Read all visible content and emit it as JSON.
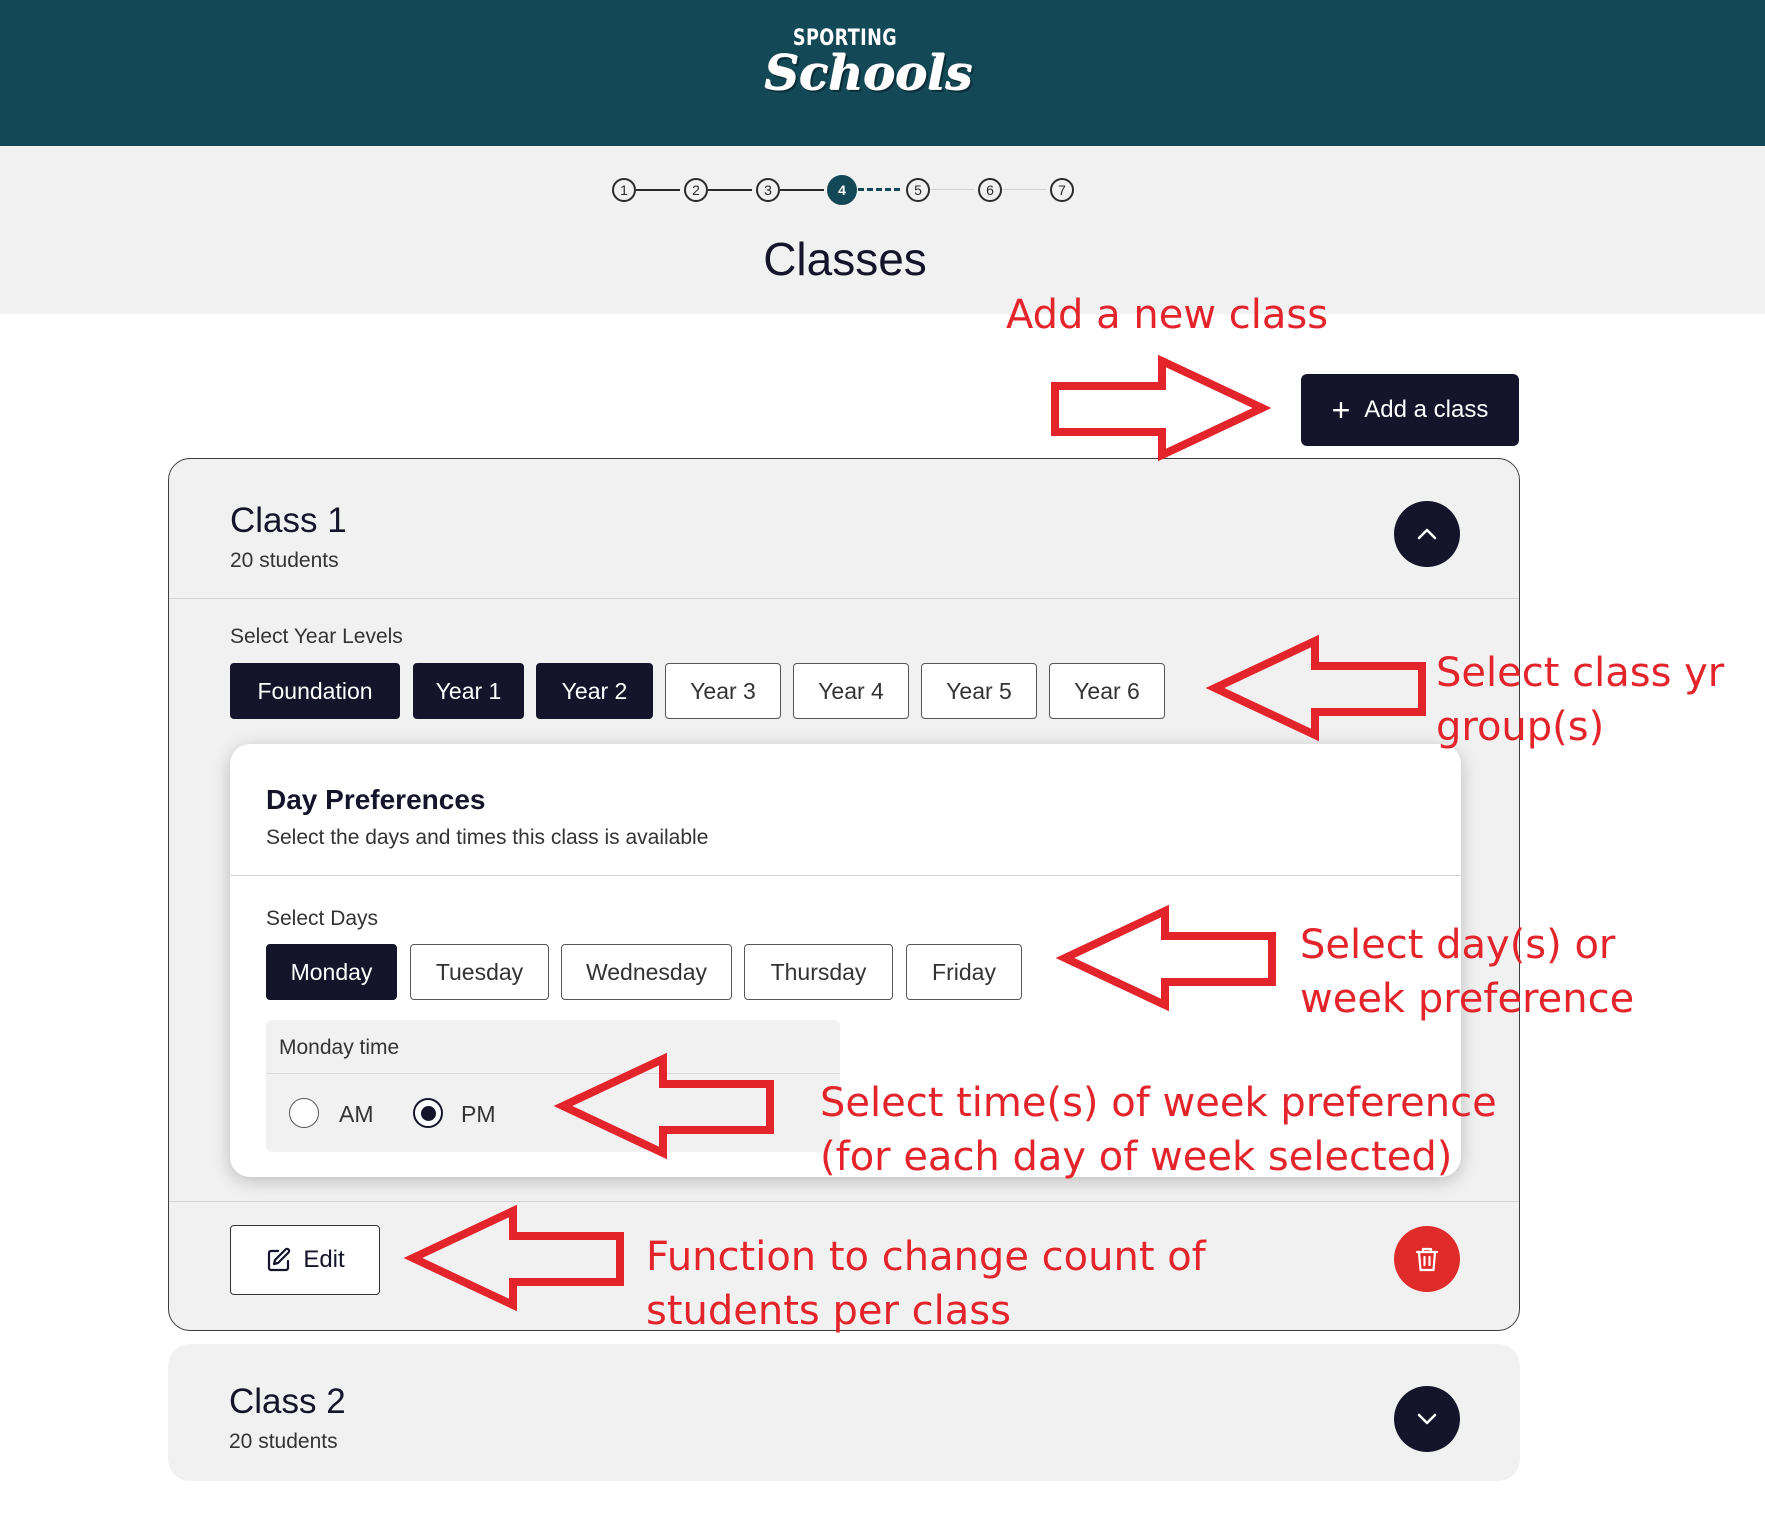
{
  "header": {
    "logo_top": "SPORTING",
    "logo_main": "Schools",
    "background_color": "#134856"
  },
  "stepper": {
    "steps": [
      "1",
      "2",
      "3",
      "4",
      "5",
      "6",
      "7"
    ],
    "current_step": 4
  },
  "page_title": "Classes",
  "add_class_button": "Add a class",
  "classes": [
    {
      "title": "Class 1",
      "students": "20 students",
      "expanded": true,
      "year_levels_label": "Select Year Levels",
      "year_levels": [
        {
          "label": "Foundation",
          "selected": true
        },
        {
          "label": "Year 1",
          "selected": true
        },
        {
          "label": "Year 2",
          "selected": true
        },
        {
          "label": "Year 3",
          "selected": false
        },
        {
          "label": "Year 4",
          "selected": false
        },
        {
          "label": "Year 5",
          "selected": false
        },
        {
          "label": "Year 6",
          "selected": false
        }
      ],
      "day_preferences": {
        "title": "Day Preferences",
        "subtitle": "Select the days and times this class is available",
        "days_label": "Select Days",
        "days": [
          {
            "label": "Monday",
            "selected": true
          },
          {
            "label": "Tuesday",
            "selected": false
          },
          {
            "label": "Wednesday",
            "selected": false
          },
          {
            "label": "Thursday",
            "selected": false
          },
          {
            "label": "Friday",
            "selected": false
          }
        ],
        "time_label": "Monday time",
        "time_options": [
          {
            "label": "AM",
            "checked": false
          },
          {
            "label": "PM",
            "checked": true
          }
        ]
      },
      "edit_button": "Edit"
    },
    {
      "title": "Class 2",
      "students": "20 students",
      "expanded": false
    }
  ],
  "annotations": {
    "add_class": "Add a new class",
    "year_group": [
      "Select class yr",
      "group(s)"
    ],
    "day_pref": [
      "Select day(s) or",
      "week preference"
    ],
    "time_pref": [
      "Select time(s) of week preference",
      "(for each day of week selected)"
    ],
    "edit": [
      "Function to change  count of",
      "students per class"
    ]
  },
  "colors": {
    "primary_dark": "#14152b",
    "delete_red": "#e02b2b",
    "annotation_red": "#e3242b"
  },
  "icons": {
    "add": "plus-icon",
    "collapse": "chevron-up-icon",
    "expand": "chevron-down-icon",
    "edit": "edit-icon",
    "delete": "trash-icon"
  }
}
